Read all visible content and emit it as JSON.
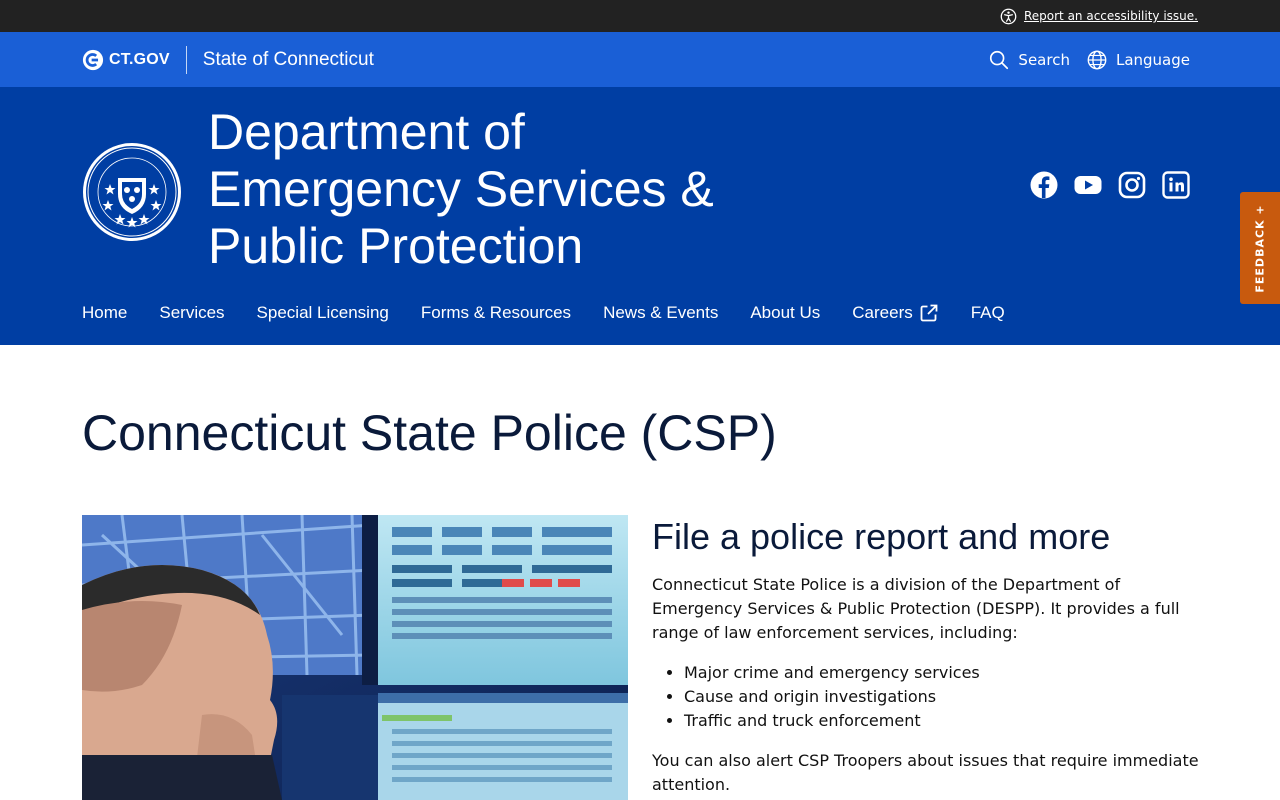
{
  "utility": {
    "a11y_link": "Report an accessibility issue."
  },
  "gov_bar": {
    "logo_text": "CT.GOV",
    "state_name": "State of Connecticut",
    "search_label": "Search",
    "language_label": "Language"
  },
  "agency": {
    "title_lines": [
      "Department of",
      "Emergency Services &",
      "Public Protection"
    ],
    "social": [
      "facebook-icon",
      "youtube-icon",
      "instagram-icon",
      "linkedin-icon"
    ]
  },
  "nav": {
    "items": [
      {
        "label": "Home"
      },
      {
        "label": "Services"
      },
      {
        "label": "Special Licensing"
      },
      {
        "label": "Forms & Resources"
      },
      {
        "label": "News & Events"
      },
      {
        "label": "About Us"
      },
      {
        "label": "Careers",
        "external": true
      },
      {
        "label": "FAQ"
      }
    ]
  },
  "feedback": {
    "label": "FEEDBACK +"
  },
  "page": {
    "title": "Connecticut State Police (CSP)",
    "section_heading": "File a police report and more",
    "intro": "Connecticut State Police is a division of the Department of Emergency Services & Public Protection (DESPP). It provides a full range of law enforcement services, including:",
    "services": [
      "Major crime and emergency services",
      "Cause and origin investigations",
      "Traffic and truck enforcement"
    ],
    "alert_text": "You can also alert CSP Troopers about issues that require immediate attention."
  },
  "colors": {
    "gov_bar": "#1a5fd6",
    "agency_header": "#003ea3",
    "feedback": "#c85a0e",
    "util_bar": "#222222"
  }
}
